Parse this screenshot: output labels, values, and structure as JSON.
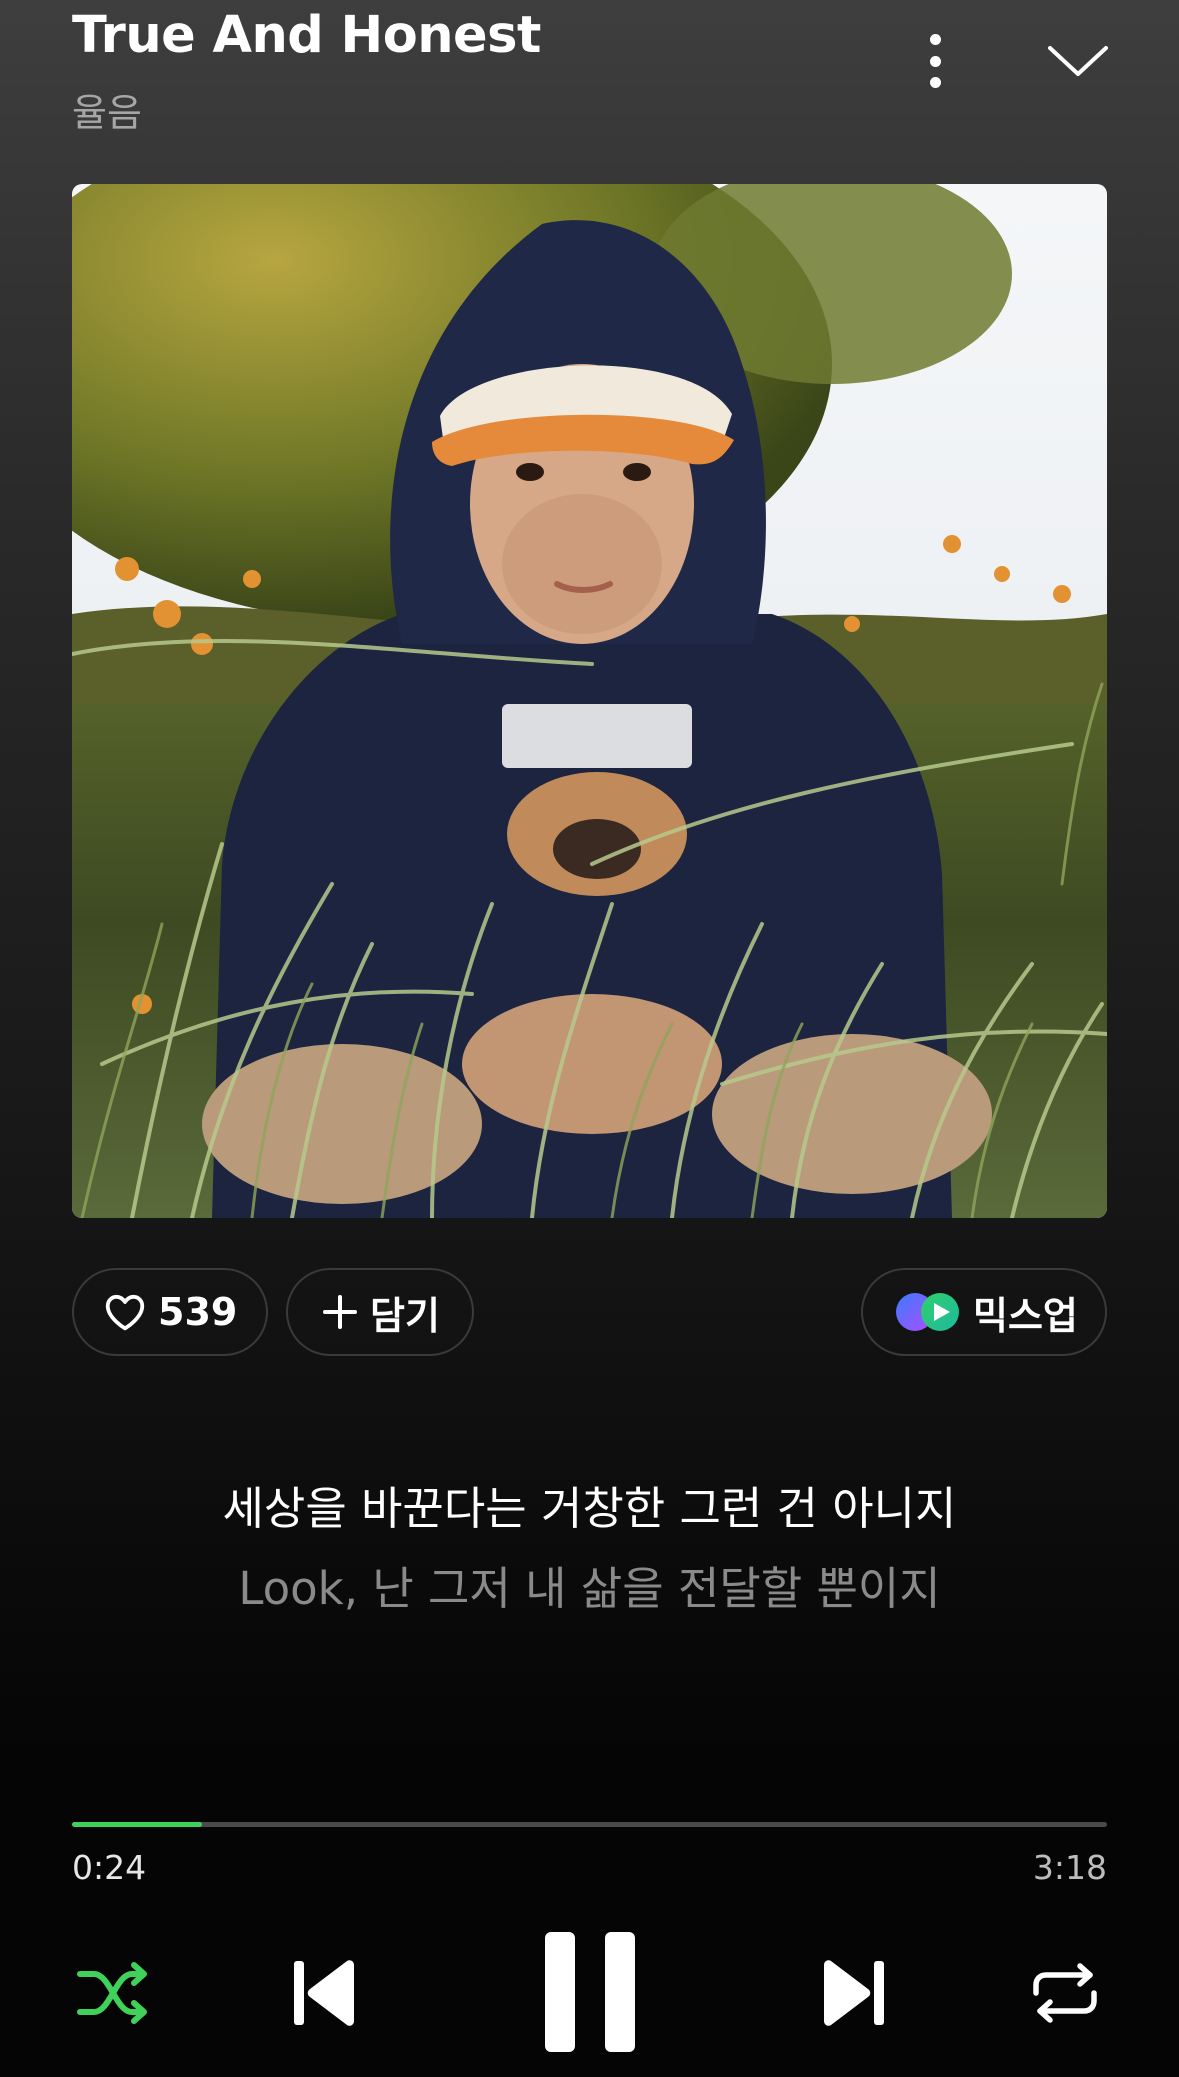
{
  "header": {
    "title": "True And Honest",
    "artist": "율음"
  },
  "icons": {
    "more": "more-vertical-icon",
    "collapse": "chevron-down-icon",
    "like": "heart-icon",
    "add": "plus-icon",
    "mixup": "mixup-logo-icon",
    "shuffle": "shuffle-icon",
    "previous": "skip-previous-icon",
    "pause": "pause-icon",
    "next": "skip-next-icon",
    "repeat": "repeat-icon"
  },
  "actions": {
    "like_count": "539",
    "add_label": "담기",
    "mixup_label": "믹스업"
  },
  "lyrics": {
    "current": "세상을 바꾼다는 거창한 그런 건 아니지",
    "next": "Look, 난 그저 내 삶을 전달할 뿐이지"
  },
  "player": {
    "elapsed": "0:24",
    "duration": "3:18",
    "progress_fraction": 0.126,
    "state": "playing"
  },
  "colors": {
    "accent": "#3fd15a",
    "secondary_text": "#a6a6a6",
    "lyric_dim": "#8a8a8a"
  }
}
